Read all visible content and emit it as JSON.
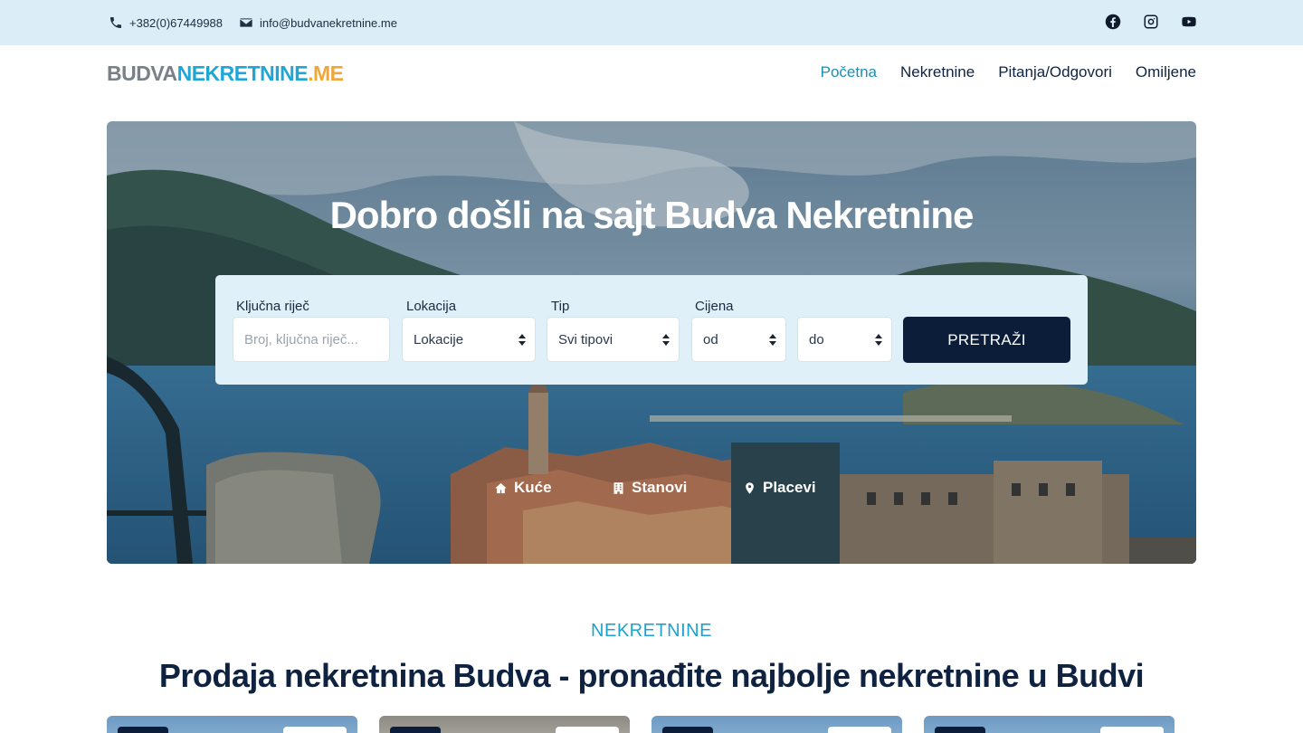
{
  "topbar": {
    "phone": "+382(0)67449988",
    "email": "info@budvanekretnine.me",
    "social": [
      "facebook-icon",
      "instagram-icon",
      "youtube-icon"
    ]
  },
  "header": {
    "logo_part1": "BUDVA",
    "logo_part2": "NEKRETNINE",
    "logo_part3": ".ME",
    "nav": [
      "Početna",
      "Nekretnine",
      "Pitanja/Odgovori",
      "Omiljene"
    ],
    "active_nav": "Početna"
  },
  "hero": {
    "title": "Dobro došli na sajt Budva Nekretnine",
    "search": {
      "keyword_label": "Ključna riječ",
      "keyword_placeholder": "Broj, ključna riječ...",
      "location_label": "Lokacija",
      "location_value": "Lokacije",
      "type_label": "Tip",
      "type_value": "Svi tipovi",
      "price_label": "Cijena",
      "price_from": "od",
      "price_to": "do",
      "button": "PRETRAŽI"
    },
    "categories": [
      "Kuće",
      "Stanovi",
      "Placevi"
    ]
  },
  "section": {
    "eyebrow": "NEKRETNINE",
    "title": "Prodaja nekretnina Budva - pronađite najbolje nekretnine u Budvi"
  },
  "colors": {
    "topbar_bg": "#dbeef7",
    "accent": "#1ea7d6",
    "logo_orange": "#f0a73a",
    "navy": "#0c1d3a"
  }
}
